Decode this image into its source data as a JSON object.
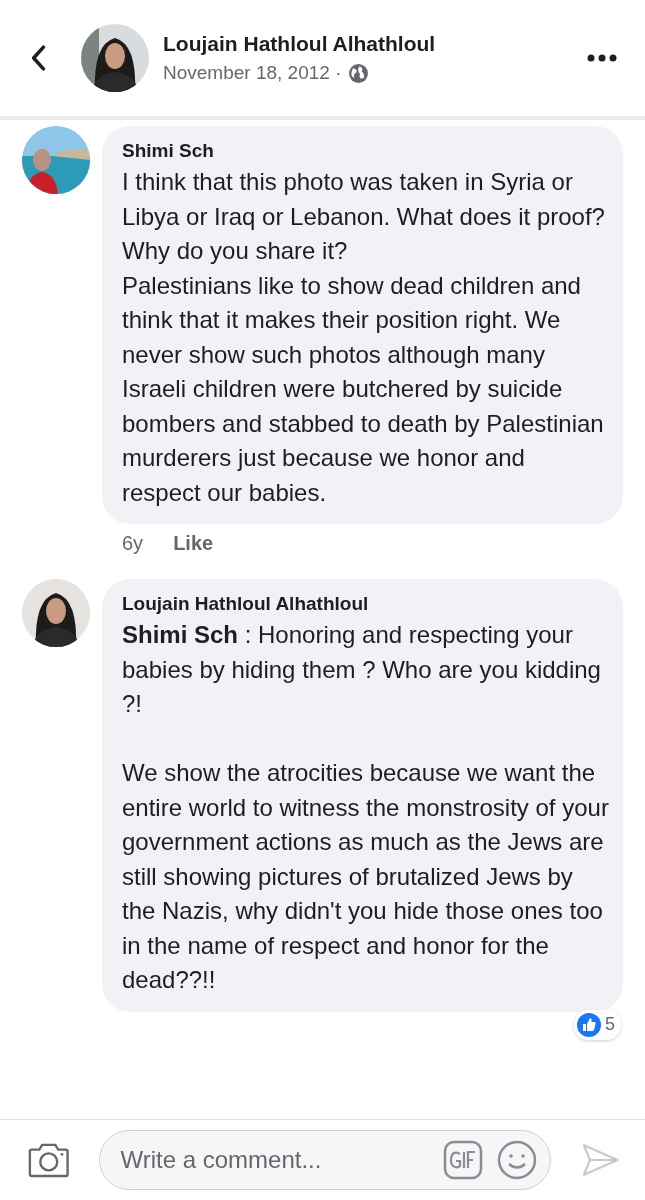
{
  "post": {
    "author": "Loujain Hathloul Alhathloul",
    "date": "November 18, 2012 ·"
  },
  "comments": [
    {
      "author": "Shimi Sch",
      "paragraphs": [
        {
          "text": "I think that this photo was taken in Syria or Libya or Iraq or Lebanon. What does it proof? Why do you share it?",
          "gap_before": false
        },
        {
          "text": "Palestinians like to show dead children and think that it makes their position right. We never show such photos although many Israeli children were butchered by suicide bombers and stabbed to death by Palestinian murderers just because we honor and respect our babies.",
          "gap_before": false
        }
      ],
      "time": "6y",
      "like": "Like"
    },
    {
      "author": "Loujain Hathloul Alhathloul",
      "paragraphs": [
        {
          "text": "**Shimi Sch** : Honoring and respecting your babies by hiding them ? Who are you kidding ?!",
          "gap_before": false
        },
        {
          "text": "We show the atrocities because we want the entire world to witness the monstrosity of your government actions as much as the Jews are still showing pictures of brutalized Jews by the Nazis, why didn't you hide those ones too in the name of respect and honor for the dead??!!",
          "gap_before": true
        }
      ],
      "reactions": "5"
    }
  ],
  "composer": {
    "placeholder": "Write a comment..."
  }
}
